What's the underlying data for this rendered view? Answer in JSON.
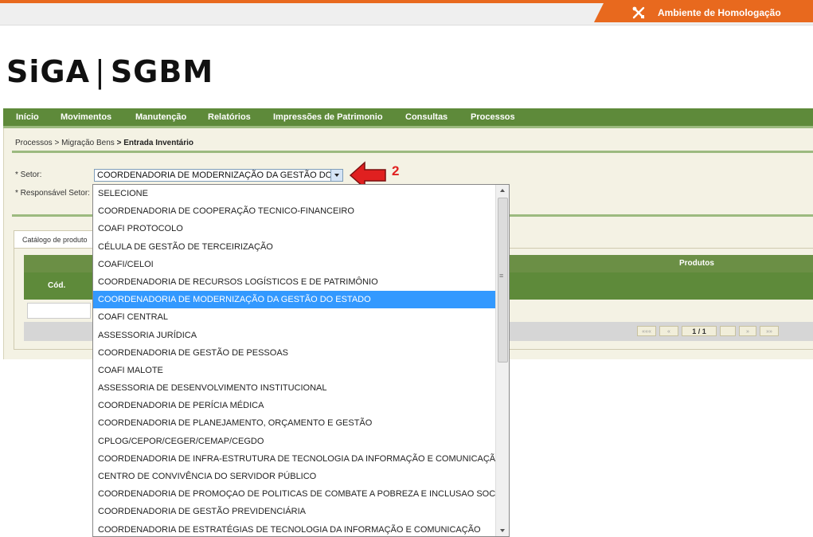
{
  "environment": {
    "label": "Ambiente de Homologação"
  },
  "logo": {
    "left": "SiGA",
    "sep": "|",
    "right": "SGBM"
  },
  "menu": [
    "Início",
    "Movimentos",
    "Manutenção",
    "Relatórios",
    "Impressões de Patrimonio",
    "Consultas",
    "Processos"
  ],
  "breadcrumb": {
    "p1": "Processos",
    "p2": "> Migração Bens",
    "p3": "> Entrada Inventário"
  },
  "form": {
    "setor_label": "* Setor:",
    "setor_value": "COORDENADORIA DE MODERNIZAÇÃO DA GESTÃO DO",
    "responsavel_label": "* Responsável Setor:"
  },
  "annotation": {
    "number": "2",
    "arrow_color": "#e02020"
  },
  "tab": {
    "label": "Catálogo de produto"
  },
  "grid": {
    "group_header": "Produtos",
    "col_cod": "Cód."
  },
  "pager": {
    "first": "«««",
    "prev": "«",
    "info": "1 / 1",
    "next": "»",
    "last": "»»"
  },
  "dropdown": {
    "selected_index": 6,
    "options": [
      "SELECIONE",
      "COORDENADORIA DE COOPERAÇÃO TECNICO-FINANCEIRO",
      "COAFI PROTOCOLO",
      "CÉLULA DE GESTÃO DE TERCEIRIZAÇÃO",
      "COAFI/CELOI",
      "COORDENADORIA DE RECURSOS LOGÍSTICOS E DE PATRIMÔNIO",
      "COORDENADORIA DE MODERNIZAÇÃO DA GESTÃO DO ESTADO",
      "COAFI CENTRAL",
      "ASSESSORIA JURÍDICA",
      "COORDENADORIA DE GESTÃO DE PESSOAS",
      "COAFI MALOTE",
      "ASSESSORIA DE DESENVOLVIMENTO INSTITUCIONAL",
      "COORDENADORIA DE PERÍCIA MÉDICA",
      "COORDENADORIA DE PLANEJAMENTO, ORÇAMENTO E GESTÃO",
      "CPLOG/CEPOR/CEGER/CEMAP/CEGDO",
      "COORDENADORIA DE INFRA-ESTRUTURA DE TECNOLOGIA DA INFORMAÇÃO E COMUNICAÇÃO",
      "CENTRO DE CONVIVÊNCIA DO SERVIDOR PÚBLICO",
      "COORDENADORIA DE PROMOÇAO DE POLITICAS DE COMBATE A POBREZA E INCLUSAO SOCIAL",
      "COORDENADORIA DE GESTÃO PREVIDENCIÁRIA",
      "COORDENADORIA DE ESTRATÉGIAS DE TECNOLOGIA DA INFORMAÇÃO E COMUNICAÇÃO"
    ]
  },
  "colors": {
    "menu_green": "#5e8a3a",
    "accent_orange": "#e8691e",
    "selection_blue": "#3399ff",
    "panel_bg": "#f4f2e4"
  }
}
